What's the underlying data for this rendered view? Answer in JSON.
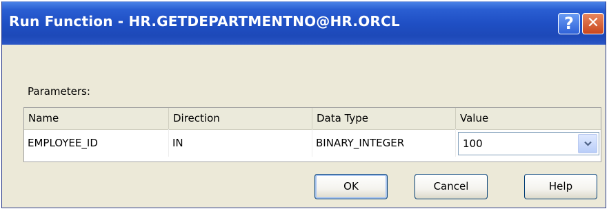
{
  "window": {
    "title": "Run Function - HR.GETDEPARTMENTNO@HR.ORCL",
    "help_glyph": "?",
    "close_glyph": "✕"
  },
  "parameters": {
    "label": "Parameters:",
    "columns": [
      "Name",
      "Direction",
      "Data Type",
      "Value"
    ],
    "rows": [
      {
        "name": "EMPLOYEE_ID",
        "direction": "IN",
        "data_type": "BINARY_INTEGER",
        "value": "100"
      }
    ]
  },
  "buttons": {
    "ok": "OK",
    "cancel": "Cancel",
    "help": "Help"
  },
  "icons": {
    "help": "help-question-icon",
    "close": "close-icon",
    "dropdown": "chevron-down-icon"
  },
  "colors": {
    "titlebar": "#1f4fc4",
    "window_bg": "#ece9d8",
    "close_button": "#c9471e"
  }
}
